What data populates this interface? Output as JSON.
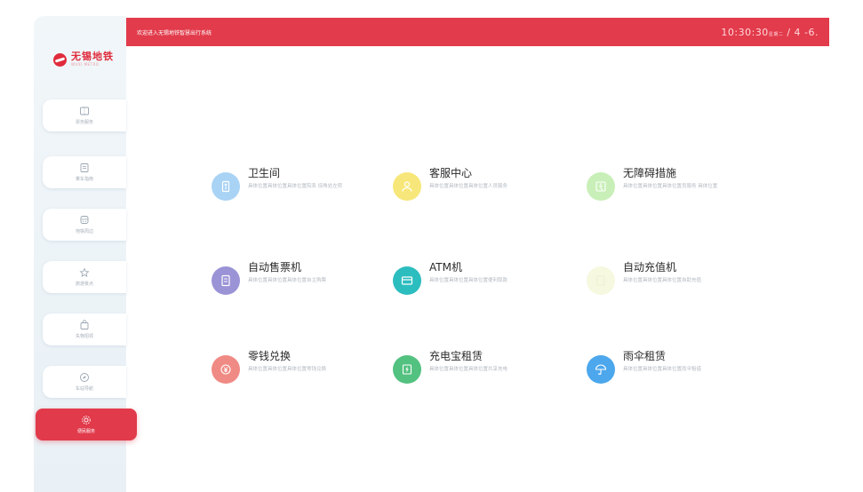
{
  "header": {
    "title": "欢迎进入无锡地铁智慧出行系统",
    "time": "10:30:30",
    "time_suffix": "星期二",
    "date": "/ 4 -6."
  },
  "logo": {
    "name_cn": "无锡地铁",
    "name_en": "WUXI METRO"
  },
  "sidebar": {
    "items": [
      {
        "label": "票务服务",
        "icon": "ticket-icon"
      },
      {
        "label": "乘车指南",
        "icon": "document-icon"
      },
      {
        "label": "地铁周边",
        "icon": "train-icon"
      },
      {
        "label": "旅游景点",
        "icon": "star-icon"
      },
      {
        "label": "失物招领",
        "icon": "bag-icon"
      },
      {
        "label": "车站导航",
        "icon": "compass-icon"
      },
      {
        "label": "便民服务",
        "icon": "gear-icon"
      }
    ],
    "active_index": 6
  },
  "services": [
    {
      "title": "卫生间",
      "desc": "具体位置具体位置具体位置院系 拐角处左转",
      "color": "#a9d3f5",
      "icon": "restroom-icon"
    },
    {
      "title": "客服中心",
      "desc": "具体位置具体位置具体位置人员服务",
      "color": "#f7e77a",
      "icon": "person-icon"
    },
    {
      "title": "无障碍措施",
      "desc": "具体位置具体位置具体位置员服务 具体位置",
      "color": "#c9efb8",
      "icon": "accessibility-icon"
    },
    {
      "title": "自动售票机",
      "desc": "具体位置具体位置具体位置自主购票",
      "color": "#9a93d6",
      "icon": "ticket-machine-icon"
    },
    {
      "title": "ATM机",
      "desc": "具体位置具体位置具体位置便利取款",
      "color": "#2cbdbf",
      "icon": "card-icon"
    },
    {
      "title": "自动充值机",
      "desc": "具体位置具体位置具体位置自助充值",
      "color": "#f6f8df",
      "icon": "recharge-icon"
    },
    {
      "title": "零钱兑换",
      "desc": "具体位置具体位置具体位置零钱兑换",
      "color": "#f08a84",
      "icon": "yuan-icon"
    },
    {
      "title": "充电宝租赁",
      "desc": "具体位置具体位置具体位置共享充电",
      "color": "#53c180",
      "icon": "powerbank-icon"
    },
    {
      "title": "雨伞租赁",
      "desc": "具体位置具体位置具体位置雨伞租借",
      "color": "#4ca7ec",
      "icon": "umbrella-icon"
    }
  ]
}
